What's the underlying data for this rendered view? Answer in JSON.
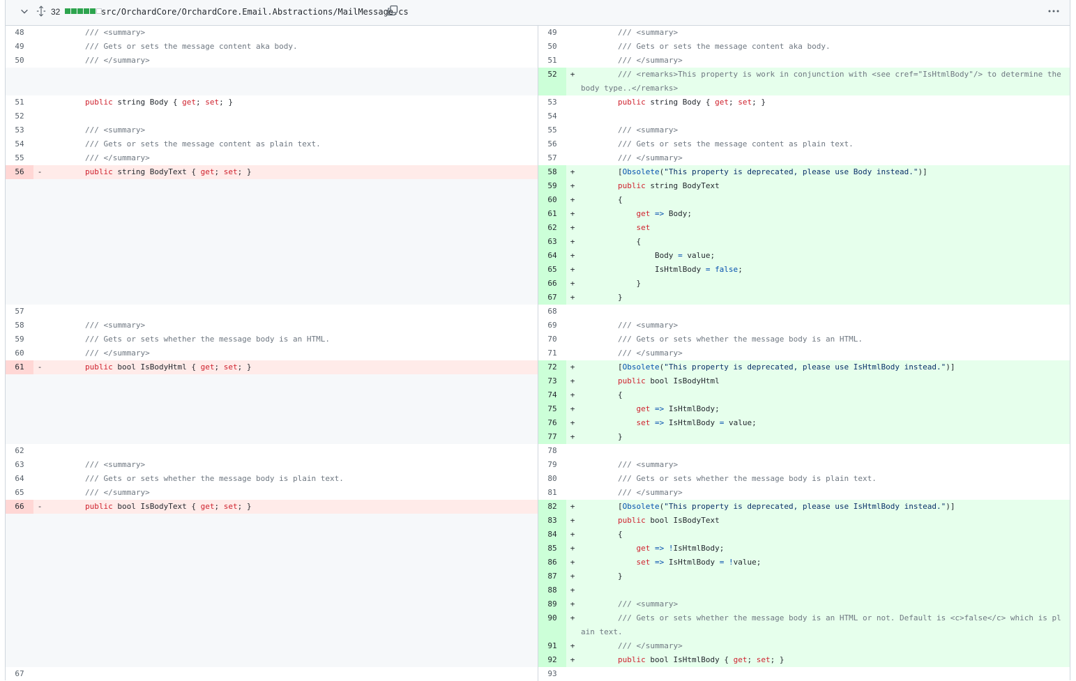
{
  "file": {
    "changes_count": "32",
    "path": "src/OrchardCore/OrchardCore.Email.Abstractions/MailMessage.cs",
    "stat_blocks": [
      "added",
      "added",
      "added",
      "added",
      "added",
      "neutral"
    ]
  },
  "icons": {
    "collapse": "chevron-down-icon",
    "expand": "unfold-icon",
    "copy": "copy-icon",
    "more": "kebab-horizontal-icon"
  },
  "colors": {
    "addition_bg": "#e6ffec",
    "addition_num_bg": "#ccffd8",
    "deletion_bg": "#ffebe9",
    "deletion_num_bg": "#ffd7d5",
    "empty_bg": "#f6f8fa"
  },
  "rows": [
    {
      "h": 1,
      "l": {
        "n": "48",
        "s": "ctx",
        "c": "        /// <summary>"
      },
      "r": {
        "n": "49",
        "s": "ctx",
        "c": "        /// <summary>"
      }
    },
    {
      "h": 1,
      "l": {
        "n": "49",
        "s": "ctx",
        "c": "        /// Gets or sets the message content aka body."
      },
      "r": {
        "n": "50",
        "s": "ctx",
        "c": "        /// Gets or sets the message content aka body."
      }
    },
    {
      "h": 1,
      "l": {
        "n": "50",
        "s": "ctx",
        "c": "        /// </summary>"
      },
      "r": {
        "n": "51",
        "s": "ctx",
        "c": "        /// </summary>"
      }
    },
    {
      "h": 2,
      "l": {
        "n": "",
        "s": "empty",
        "c": ""
      },
      "r": {
        "n": "52",
        "s": "add",
        "c": "        /// <remarks>This property is work in conjunction with <see cref=\"IsHtmlBody\"/> to determine the body type..</remarks>"
      }
    },
    {
      "h": 1,
      "l": {
        "n": "51",
        "s": "ctx",
        "c": "        public string Body { get; set; }"
      },
      "r": {
        "n": "53",
        "s": "ctx",
        "c": "        public string Body { get; set; }"
      }
    },
    {
      "h": 1,
      "l": {
        "n": "52",
        "s": "ctx",
        "c": ""
      },
      "r": {
        "n": "54",
        "s": "ctx",
        "c": ""
      }
    },
    {
      "h": 1,
      "l": {
        "n": "53",
        "s": "ctx",
        "c": "        /// <summary>"
      },
      "r": {
        "n": "55",
        "s": "ctx",
        "c": "        /// <summary>"
      }
    },
    {
      "h": 1,
      "l": {
        "n": "54",
        "s": "ctx",
        "c": "        /// Gets or sets the message content as plain text."
      },
      "r": {
        "n": "56",
        "s": "ctx",
        "c": "        /// Gets or sets the message content as plain text."
      }
    },
    {
      "h": 1,
      "l": {
        "n": "55",
        "s": "ctx",
        "c": "        /// </summary>"
      },
      "r": {
        "n": "57",
        "s": "ctx",
        "c": "        /// </summary>"
      }
    },
    {
      "h": 1,
      "l": {
        "n": "56",
        "s": "del",
        "c": "        public string BodyText { get; set; }"
      },
      "r": {
        "n": "58",
        "s": "add",
        "c": "        [Obsolete(\"This property is deprecated, please use Body instead.\")]"
      }
    },
    {
      "h": 1,
      "l": {
        "n": "",
        "s": "empty",
        "c": ""
      },
      "r": {
        "n": "59",
        "s": "add",
        "c": "        public string BodyText"
      }
    },
    {
      "h": 1,
      "l": {
        "n": "",
        "s": "empty",
        "c": ""
      },
      "r": {
        "n": "60",
        "s": "add",
        "c": "        {"
      }
    },
    {
      "h": 1,
      "l": {
        "n": "",
        "s": "empty",
        "c": ""
      },
      "r": {
        "n": "61",
        "s": "add",
        "c": "            get => Body;"
      }
    },
    {
      "h": 1,
      "l": {
        "n": "",
        "s": "empty",
        "c": ""
      },
      "r": {
        "n": "62",
        "s": "add",
        "c": "            set"
      }
    },
    {
      "h": 1,
      "l": {
        "n": "",
        "s": "empty",
        "c": ""
      },
      "r": {
        "n": "63",
        "s": "add",
        "c": "            {"
      }
    },
    {
      "h": 1,
      "l": {
        "n": "",
        "s": "empty",
        "c": ""
      },
      "r": {
        "n": "64",
        "s": "add",
        "c": "                Body = value;"
      }
    },
    {
      "h": 1,
      "l": {
        "n": "",
        "s": "empty",
        "c": ""
      },
      "r": {
        "n": "65",
        "s": "add",
        "c": "                IsHtmlBody = false;"
      }
    },
    {
      "h": 1,
      "l": {
        "n": "",
        "s": "empty",
        "c": ""
      },
      "r": {
        "n": "66",
        "s": "add",
        "c": "            }"
      }
    },
    {
      "h": 1,
      "l": {
        "n": "",
        "s": "empty",
        "c": ""
      },
      "r": {
        "n": "67",
        "s": "add",
        "c": "        }"
      }
    },
    {
      "h": 1,
      "l": {
        "n": "57",
        "s": "ctx",
        "c": ""
      },
      "r": {
        "n": "68",
        "s": "ctx",
        "c": ""
      }
    },
    {
      "h": 1,
      "l": {
        "n": "58",
        "s": "ctx",
        "c": "        /// <summary>"
      },
      "r": {
        "n": "69",
        "s": "ctx",
        "c": "        /// <summary>"
      }
    },
    {
      "h": 1,
      "l": {
        "n": "59",
        "s": "ctx",
        "c": "        /// Gets or sets whether the message body is an HTML."
      },
      "r": {
        "n": "70",
        "s": "ctx",
        "c": "        /// Gets or sets whether the message body is an HTML."
      }
    },
    {
      "h": 1,
      "l": {
        "n": "60",
        "s": "ctx",
        "c": "        /// </summary>"
      },
      "r": {
        "n": "71",
        "s": "ctx",
        "c": "        /// </summary>"
      }
    },
    {
      "h": 1,
      "l": {
        "n": "61",
        "s": "del",
        "c": "        public bool IsBodyHtml { get; set; }"
      },
      "r": {
        "n": "72",
        "s": "add",
        "c": "        [Obsolete(\"This property is deprecated, please use IsHtmlBody instead.\")]"
      }
    },
    {
      "h": 1,
      "l": {
        "n": "",
        "s": "empty",
        "c": ""
      },
      "r": {
        "n": "73",
        "s": "add",
        "c": "        public bool IsBodyHtml"
      }
    },
    {
      "h": 1,
      "l": {
        "n": "",
        "s": "empty",
        "c": ""
      },
      "r": {
        "n": "74",
        "s": "add",
        "c": "        {"
      }
    },
    {
      "h": 1,
      "l": {
        "n": "",
        "s": "empty",
        "c": ""
      },
      "r": {
        "n": "75",
        "s": "add",
        "c": "            get => IsHtmlBody;"
      }
    },
    {
      "h": 1,
      "l": {
        "n": "",
        "s": "empty",
        "c": ""
      },
      "r": {
        "n": "76",
        "s": "add",
        "c": "            set => IsHtmlBody = value;"
      }
    },
    {
      "h": 1,
      "l": {
        "n": "",
        "s": "empty",
        "c": ""
      },
      "r": {
        "n": "77",
        "s": "add",
        "c": "        }"
      }
    },
    {
      "h": 1,
      "l": {
        "n": "62",
        "s": "ctx",
        "c": ""
      },
      "r": {
        "n": "78",
        "s": "ctx",
        "c": ""
      }
    },
    {
      "h": 1,
      "l": {
        "n": "63",
        "s": "ctx",
        "c": "        /// <summary>"
      },
      "r": {
        "n": "79",
        "s": "ctx",
        "c": "        /// <summary>"
      }
    },
    {
      "h": 1,
      "l": {
        "n": "64",
        "s": "ctx",
        "c": "        /// Gets or sets whether the message body is plain text."
      },
      "r": {
        "n": "80",
        "s": "ctx",
        "c": "        /// Gets or sets whether the message body is plain text."
      }
    },
    {
      "h": 1,
      "l": {
        "n": "65",
        "s": "ctx",
        "c": "        /// </summary>"
      },
      "r": {
        "n": "81",
        "s": "ctx",
        "c": "        /// </summary>"
      }
    },
    {
      "h": 1,
      "l": {
        "n": "66",
        "s": "del",
        "c": "        public bool IsBodyText { get; set; }"
      },
      "r": {
        "n": "82",
        "s": "add",
        "c": "        [Obsolete(\"This property is deprecated, please use IsHtmlBody instead.\")]"
      }
    },
    {
      "h": 1,
      "l": {
        "n": "",
        "s": "empty",
        "c": ""
      },
      "r": {
        "n": "83",
        "s": "add",
        "c": "        public bool IsBodyText"
      }
    },
    {
      "h": 1,
      "l": {
        "n": "",
        "s": "empty",
        "c": ""
      },
      "r": {
        "n": "84",
        "s": "add",
        "c": "        {"
      }
    },
    {
      "h": 1,
      "l": {
        "n": "",
        "s": "empty",
        "c": ""
      },
      "r": {
        "n": "85",
        "s": "add",
        "c": "            get => !IsHtmlBody;"
      }
    },
    {
      "h": 1,
      "l": {
        "n": "",
        "s": "empty",
        "c": ""
      },
      "r": {
        "n": "86",
        "s": "add",
        "c": "            set => IsHtmlBody = !value;"
      }
    },
    {
      "h": 1,
      "l": {
        "n": "",
        "s": "empty",
        "c": ""
      },
      "r": {
        "n": "87",
        "s": "add",
        "c": "        }"
      }
    },
    {
      "h": 1,
      "l": {
        "n": "",
        "s": "empty",
        "c": ""
      },
      "r": {
        "n": "88",
        "s": "add",
        "c": ""
      }
    },
    {
      "h": 1,
      "l": {
        "n": "",
        "s": "empty",
        "c": ""
      },
      "r": {
        "n": "89",
        "s": "add",
        "c": "        /// <summary>"
      }
    },
    {
      "h": 2,
      "l": {
        "n": "",
        "s": "empty",
        "c": ""
      },
      "r": {
        "n": "90",
        "s": "add",
        "c": "        /// Gets or sets whether the message body is an HTML or not. Default is <c>false</c> which is plain text."
      }
    },
    {
      "h": 1,
      "l": {
        "n": "",
        "s": "empty",
        "c": ""
      },
      "r": {
        "n": "91",
        "s": "add",
        "c": "        /// </summary>"
      }
    },
    {
      "h": 1,
      "l": {
        "n": "",
        "s": "empty",
        "c": ""
      },
      "r": {
        "n": "92",
        "s": "add",
        "c": "        public bool IsHtmlBody { get; set; }"
      }
    },
    {
      "h": 1,
      "l": {
        "n": "67",
        "s": "ctx",
        "c": ""
      },
      "r": {
        "n": "93",
        "s": "ctx",
        "c": ""
      }
    }
  ]
}
